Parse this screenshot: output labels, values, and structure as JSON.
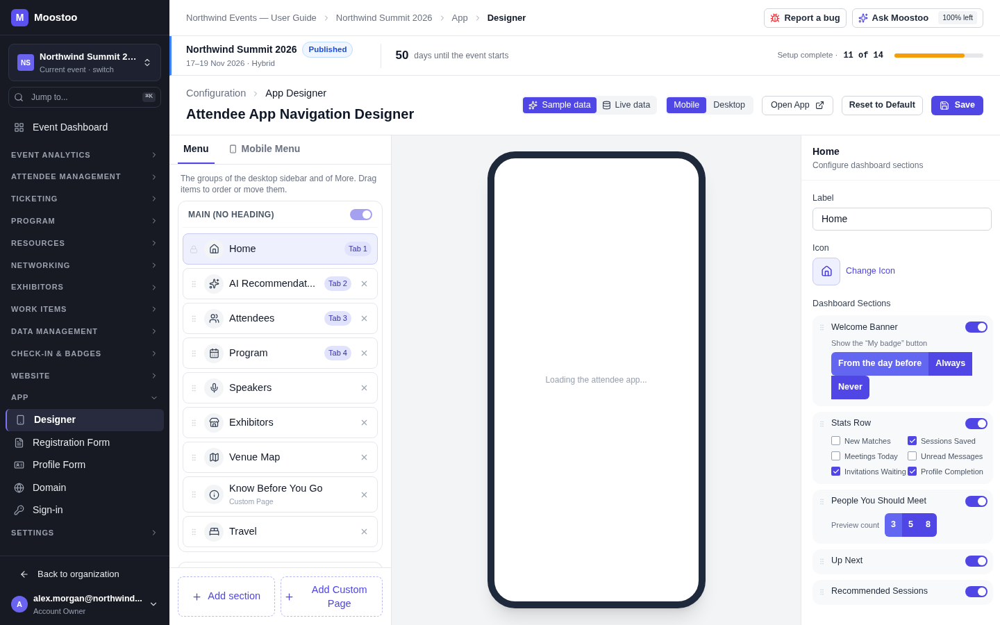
{
  "app": {
    "logo": "M",
    "name": "Moostoo"
  },
  "event_switcher": {
    "initials": "NS",
    "name": "Northwind Summit 2…",
    "subtitle": "Current event · switch"
  },
  "jump": {
    "placeholder": "Jump to...",
    "shortcut": "⌘K"
  },
  "sidebar": {
    "items": [
      {
        "kind": "link",
        "label": "Event Dashboard",
        "selected": false
      },
      {
        "kind": "group",
        "label": "EVENT ANALYTICS",
        "expanded": false
      },
      {
        "kind": "group",
        "label": "ATTENDEE MANAGEMENT",
        "expanded": false
      },
      {
        "kind": "group",
        "label": "TICKETING",
        "expanded": false
      },
      {
        "kind": "group",
        "label": "PROGRAM",
        "expanded": false
      },
      {
        "kind": "group",
        "label": "RESOURCES",
        "expanded": false
      },
      {
        "kind": "group",
        "label": "NETWORKING",
        "expanded": false
      },
      {
        "kind": "group",
        "label": "EXHIBITORS",
        "expanded": false
      },
      {
        "kind": "group",
        "label": "WORK ITEMS",
        "expanded": false
      },
      {
        "kind": "group",
        "label": "DATA MANAGEMENT",
        "expanded": false
      },
      {
        "kind": "group",
        "label": "CHECK-IN & BADGES",
        "expanded": false
      },
      {
        "kind": "group",
        "label": "WEBSITE",
        "expanded": false
      },
      {
        "kind": "group",
        "label": "APP",
        "expanded": true,
        "children": [
          {
            "label": "Designer",
            "selected": true
          },
          {
            "label": "Registration Form",
            "selected": false
          },
          {
            "label": "Profile Form",
            "selected": false
          },
          {
            "label": "Domain",
            "selected": false
          },
          {
            "label": "Sign-in",
            "selected": false
          }
        ]
      },
      {
        "kind": "group",
        "label": "SETTINGS",
        "expanded": false
      }
    ]
  },
  "back_link": "Back to organization",
  "user": {
    "initial": "A",
    "email": "alex.morgan@northwind...",
    "role": "Account Owner"
  },
  "breadcrumbs": [
    "Northwind Events — User Guide",
    "Northwind Summit 2026",
    "App",
    "Designer"
  ],
  "top_actions": {
    "report": "Report a bug",
    "ask": "Ask Moostoo",
    "quota": "100% left"
  },
  "event": {
    "name": "Northwind Summit 2026",
    "status": "Published",
    "dates": "17–19 Nov 2026 · Hybrid",
    "days": "50",
    "days_text": "days until the event starts",
    "setup_label": "Setup complete ·",
    "setup_count": "11 of 14",
    "level": 0.79
  },
  "page": {
    "crumbs": [
      "Configuration",
      "App Designer"
    ],
    "title": "Attendee App Navigation Designer"
  },
  "data_toggle": [
    {
      "label": "Sample data",
      "selected": true
    },
    {
      "label": "Live data",
      "selected": false
    }
  ],
  "device_toggle": [
    {
      "label": "Mobile",
      "selected": true
    },
    {
      "label": "Desktop",
      "selected": false
    }
  ],
  "buttons": [
    {
      "kind": "open",
      "label": "Open App"
    },
    {
      "kind": "reset",
      "label": "Reset to Default"
    },
    {
      "kind": "save",
      "label": "Save"
    }
  ],
  "menu_tabs": [
    {
      "label": "Menu",
      "selected": true
    },
    {
      "label": "Mobile Menu",
      "selected": false
    }
  ],
  "menu_hint": "The groups of the desktop sidebar and of More. Drag items to order or move them.",
  "menu_section": {
    "title": "MAIN (NO HEADING)",
    "on": true,
    "items": [
      {
        "label": "Home",
        "tab": "Tab 1",
        "locked": true,
        "selected": true
      },
      {
        "label": "AI Recommendat...",
        "tab": "Tab 2",
        "locked": false,
        "selected": false
      },
      {
        "label": "Attendees",
        "tab": "Tab 3",
        "locked": false,
        "selected": false
      },
      {
        "label": "Program",
        "tab": "Tab 4",
        "locked": false,
        "selected": false
      },
      {
        "label": "Speakers",
        "locked": false,
        "selected": false
      },
      {
        "label": "Exhibitors",
        "locked": false,
        "selected": false
      },
      {
        "label": "Venue Map",
        "locked": false,
        "selected": false
      },
      {
        "label": "Know Before You Go",
        "subtitle": "Custom Page",
        "locked": false,
        "selected": false
      },
      {
        "label": "Travel",
        "locked": false,
        "selected": false
      }
    ]
  },
  "menu_actions": {
    "add_section": "Add section",
    "add_page": "Add Custom Page"
  },
  "preview": {
    "loading": "Loading the attendee app..."
  },
  "inspector": {
    "title": "Home",
    "subtitle": "Configure dashboard sections",
    "label_caption": "Label",
    "label_value": "Home",
    "icon_caption": "Icon",
    "change_icon": "Change Icon",
    "sections_caption": "Dashboard Sections",
    "sections": [
      {
        "kind": "options",
        "title": "Welcome Banner",
        "on": true,
        "hint": "Show the “My badge” button",
        "options": [
          {
            "label": "From the day before",
            "selected": true
          },
          {
            "label": "Always",
            "selected": false
          },
          {
            "label": "Never",
            "selected": false
          }
        ]
      },
      {
        "kind": "checks",
        "title": "Stats Row",
        "on": true,
        "checks": [
          {
            "label": "New Matches",
            "checked": false
          },
          {
            "label": "Sessions Saved",
            "checked": true
          },
          {
            "label": "Meetings Today",
            "checked": false
          },
          {
            "label": "Unread Messages",
            "checked": false
          },
          {
            "label": "Invitations Waiting",
            "checked": true
          },
          {
            "label": "Profile Completion",
            "checked": true
          }
        ]
      },
      {
        "kind": "count",
        "title": "People You Should Meet",
        "on": true,
        "caption": "Preview count",
        "options": [
          {
            "label": "3",
            "selected": true
          },
          {
            "label": "5",
            "selected": false
          },
          {
            "label": "8",
            "selected": false
          }
        ]
      },
      {
        "kind": "plain",
        "title": "Up Next",
        "on": true
      },
      {
        "kind": "plain",
        "title": "Recommended Sessions",
        "on": true
      }
    ]
  }
}
